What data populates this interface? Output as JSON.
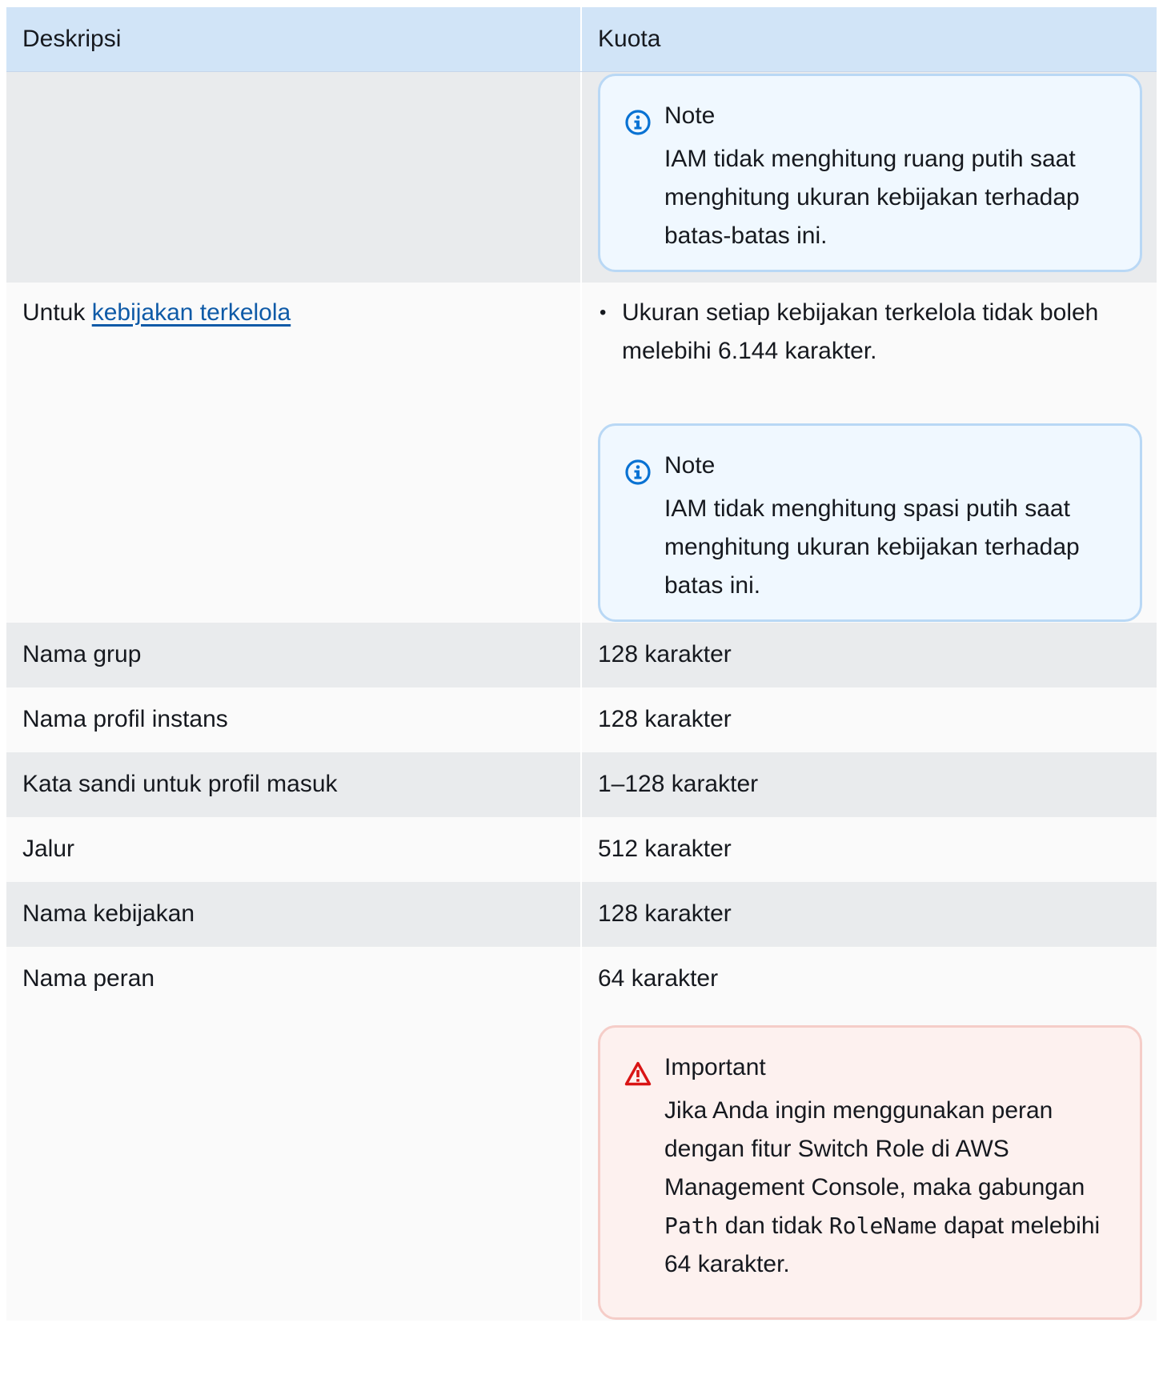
{
  "table": {
    "headers": {
      "description": "Deskripsi",
      "quota": "Kuota"
    },
    "row_top_note": {
      "title": "Note",
      "body": "IAM tidak menghitung ruang putih saat menghitung ukuran kebijakan terhadap batas-batas ini."
    },
    "row_managed": {
      "label_prefix": "Untuk ",
      "label_link": "kebijakan terkelola",
      "bullet": "Ukuran setiap kebijakan terkelola tidak boleh melebihi 6.144 karakter.",
      "note_title": "Note",
      "note_body": "IAM tidak menghitung spasi putih saat menghitung ukuran kebijakan terhadap batas ini."
    },
    "rows": [
      {
        "description": "Nama grup",
        "quota": "128 karakter"
      },
      {
        "description": "Nama profil instans",
        "quota": "128 karakter"
      },
      {
        "description": "Kata sandi untuk profil masuk",
        "quota": "1–128 karakter"
      },
      {
        "description": "Jalur",
        "quota": "512 karakter"
      },
      {
        "description": "Nama kebijakan",
        "quota": "128 karakter"
      }
    ],
    "row_role": {
      "description": "Nama peran",
      "quota": "64 karakter",
      "important_title": "Important",
      "important_text_1": "Jika Anda ingin menggunakan peran dengan fitur Switch Role di AWS Management Console, maka gabungan ",
      "important_code_1": "Path",
      "important_text_2": " dan tidak ",
      "important_code_2": "RoleName",
      "important_text_3": " dapat melebihi 64 karakter."
    }
  },
  "icons": {
    "note": "info-circle-icon",
    "important": "warning-triangle-icon"
  },
  "colors": {
    "header_bg": "#d1e4f7",
    "shade_row": "#e9ebed",
    "plain_row": "#fafafa",
    "link": "#0e5aa7",
    "info_blue": "#0972d3",
    "warning_red": "#d91515"
  }
}
